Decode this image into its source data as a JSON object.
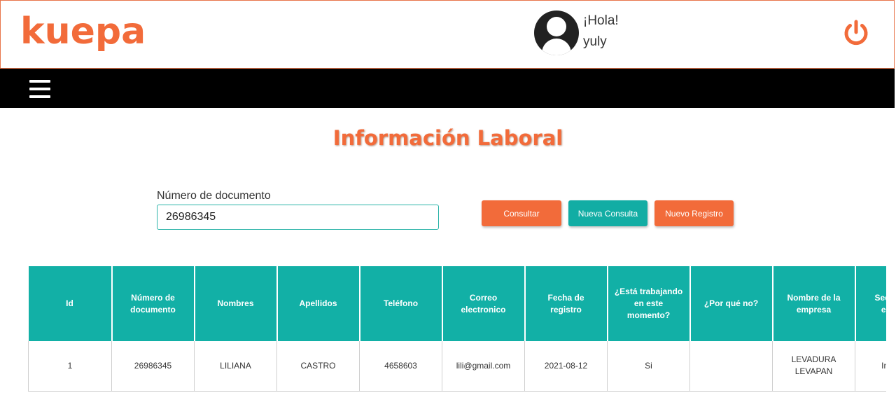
{
  "header": {
    "logo": "kuepa",
    "greeting": "¡Hola!",
    "username": "yuly"
  },
  "icons": {
    "avatar": "user-avatar-icon",
    "power": "power-icon",
    "menu": "hamburger-menu-icon"
  },
  "colors": {
    "brand_orange": "#f26b3a",
    "teal": "#12ada4",
    "navbar": "#000000"
  },
  "page_title": "Información Laboral",
  "search": {
    "label": "Número de documento",
    "value": "26986345"
  },
  "buttons": {
    "consultar": "Consultar",
    "nueva_consulta": "Nueva Consulta",
    "nuevo_registro": "Nuevo Registro"
  },
  "table": {
    "columns": [
      "Id",
      "Número de documento",
      "Nombres",
      "Apellidos",
      "Teléfono",
      "Correo electronico",
      "Fecha de registro",
      "¿Está trabajando en este momento?",
      "¿Por qué no?",
      "Nombre de la empresa",
      "Sector de la empresa"
    ],
    "rows": [
      [
        "1",
        "26986345",
        "LILIANA",
        "CASTRO",
        "4658603",
        "lili@gmail.com",
        "2021-08-12",
        "Si",
        "",
        "LEVADURA LEVAPAN",
        "Industrial"
      ]
    ]
  }
}
